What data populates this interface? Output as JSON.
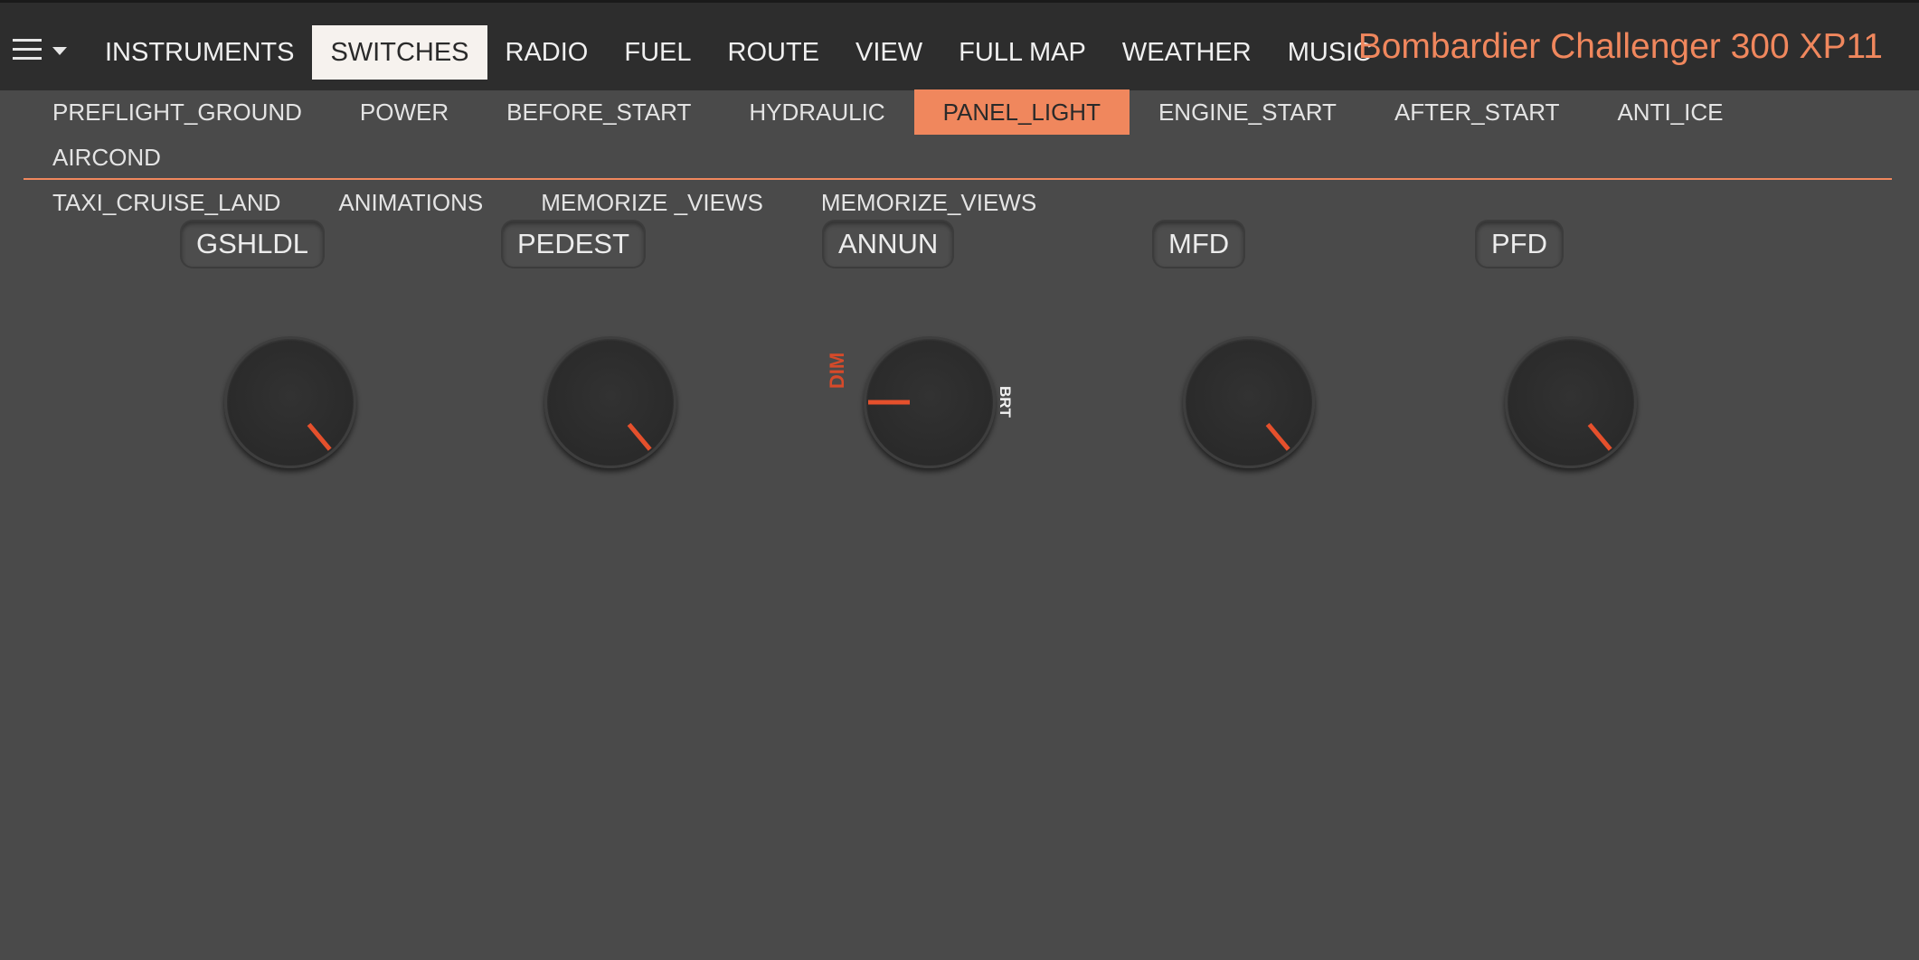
{
  "app_title": "Bombardier Challenger 300 XP11",
  "colors": {
    "accent": "#f0875d",
    "pointer": "#e5502c",
    "topbar": "#2d2d2d",
    "background": "#4a4a4a"
  },
  "menu": {
    "icon": "hamburger-menu-icon",
    "caret_icon": "chevron-down-icon"
  },
  "main_tabs": [
    {
      "label": "INSTRUMENTS",
      "active": false
    },
    {
      "label": "SWITCHES",
      "active": true
    },
    {
      "label": "RADIO",
      "active": false
    },
    {
      "label": "FUEL",
      "active": false
    },
    {
      "label": "ROUTE",
      "active": false
    },
    {
      "label": "VIEW",
      "active": false
    },
    {
      "label": "FULL MAP",
      "active": false
    },
    {
      "label": "WEATHER",
      "active": false
    },
    {
      "label": "MUSIC",
      "active": false
    }
  ],
  "sub_tabs": [
    {
      "label": "PREFLIGHT_GROUND",
      "active": false
    },
    {
      "label": "POWER",
      "active": false
    },
    {
      "label": "BEFORE_START",
      "active": false
    },
    {
      "label": "HYDRAULIC",
      "active": false
    },
    {
      "label": "PANEL_LIGHT",
      "active": true
    },
    {
      "label": "ENGINE_START",
      "active": false
    },
    {
      "label": "AFTER_START",
      "active": false
    },
    {
      "label": "ANTI_ICE",
      "active": false
    },
    {
      "label": "AIRCOND",
      "active": false
    },
    {
      "label": "TAXI_CRUISE_LAND",
      "active": false
    },
    {
      "label": "ANIMATIONS",
      "active": false
    },
    {
      "label": "MEMORIZE _VIEWS",
      "active": false
    },
    {
      "label": "MEMORIZE_VIEWS",
      "active": false
    }
  ],
  "knobs": [
    {
      "label": "GSHLDL",
      "pointer_angle_deg": 140
    },
    {
      "label": "PEDEST",
      "pointer_angle_deg": 140
    },
    {
      "label": "ANNUN",
      "pointer_angle_deg": 270
    },
    {
      "label": "MFD",
      "pointer_angle_deg": 140
    },
    {
      "label": "PFD",
      "pointer_angle_deg": 140
    }
  ],
  "annun_scale": {
    "min_label": "DIM",
    "max_label": "BRT"
  }
}
